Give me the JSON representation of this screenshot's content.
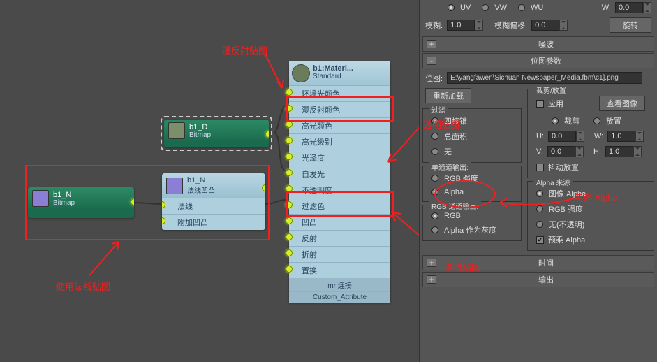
{
  "annotations": {
    "diffuse_map": "漫反射贴图",
    "use_normal_map": "使用法线贴图",
    "opacity_map": "透明贴图",
    "check_alpha": "勾选 Alpha",
    "normal_map": "法线贴图"
  },
  "nodes": {
    "b1_d": {
      "title": "b1_D",
      "type": "Bitmap"
    },
    "b1_n": {
      "title": "b1_N",
      "type": "Bitmap"
    },
    "normal_bump": {
      "title": "b1_N",
      "subtitle": "法线凹凸",
      "rows": [
        "法线",
        "附加凹凸"
      ]
    },
    "material": {
      "title": "b1:Materi...",
      "subtitle": "Standard",
      "rows": [
        "环境光颜色",
        "漫反射颜色",
        "高光颜色",
        "高光级别",
        "光泽度",
        "自发光",
        "不透明度",
        "过滤色",
        "凹凸",
        "反射",
        "折射",
        "置换"
      ],
      "footer1": "mr 连接",
      "footer2": "Custom_Attribute"
    }
  },
  "panel": {
    "uv": "UV",
    "vw": "VW",
    "wu": "WU",
    "w_lbl": "W:",
    "w_val": "0.0",
    "blur_lbl": "模糊:",
    "blur_val": "1.0",
    "blur_off_lbl": "模糊偏移:",
    "blur_off_val": "0.0",
    "rotate": "旋转",
    "noise": "噪波",
    "bmp_params": "位图参数",
    "bmp_lbl": "位图:",
    "bmp_path": "E:\\yangfawen\\Sichuan Newspaper_Media.fbm\\c1].png",
    "reload": "重新加载",
    "crop_group": "裁剪/放置",
    "apply": "应用",
    "view_image": "查看图像",
    "crop": "裁剪",
    "place": "放置",
    "u_lbl": "U:",
    "u_val": "0.0",
    "w2_lbl": "W:",
    "w2_val": "1.0",
    "v_lbl": "V:",
    "v_val": "0.0",
    "h_lbl": "H:",
    "h_val": "1.0",
    "jitter": "抖动放置:",
    "filter_group": "过滤",
    "pyramid": "四棱锥",
    "sum_area": "总面积",
    "none": "无",
    "mono_group": "单通道输出:",
    "rgb_int": "RGB 强度",
    "alpha": "Alpha",
    "rgb_out_group": "RGB 通道输出:",
    "rgb": "RGB",
    "alpha_gray": "Alpha 作为灰度",
    "alpha_src_group": "Alpha 来源",
    "img_alpha": "图像 Alpha",
    "rgb_int2": "RGB 强度",
    "none_opaque": "无(不透明)",
    "premult": "预乘 Alpha",
    "time": "时间",
    "output": "输出"
  }
}
